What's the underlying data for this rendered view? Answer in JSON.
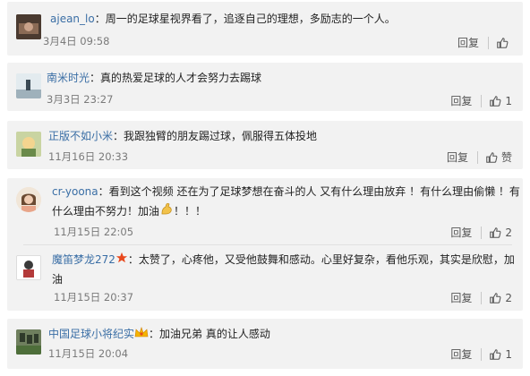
{
  "comments": [
    {
      "user": "ajean_lo",
      "text": "周一的足球星视界看了，追逐自己的理想，多励志的一个人。",
      "time": "3月4日 09:58",
      "reply_label": "回复",
      "like": ""
    },
    {
      "user": "南米时光",
      "text": "真的热爱足球的人才会努力去踢球",
      "time": "3月3日 23:27",
      "reply_label": "回复",
      "like": "1"
    },
    {
      "user": "正版不如小米",
      "text": "我跟独臂的朋友踢过球，佩服得五体投地",
      "time": "11月16日 20:33",
      "reply_label": "回复",
      "like": "赞"
    },
    {
      "user": "cr-yoona",
      "text_line1": "看到这个视频 还在为了足球梦想在奋斗的人 又有什么理由放弃 ！有什么理由偷懒 ！有",
      "text_line2": "什么理由不努力！加油",
      "text_line2_tail": "！！！",
      "time": "11月15日 22:05",
      "reply_label": "回复",
      "like": "2"
    },
    {
      "user": "魔笛梦龙272",
      "text_line1": "太赞了，心疼他，又受他鼓舞和感动。心里好复杂，看他乐观，其实是欣慰，加",
      "text_line2": "油",
      "time": "11月15日 20:37",
      "reply_label": "回复",
      "like": "2"
    },
    {
      "user": "中国足球小将纪实",
      "text": "加油兄弟 真的让人感动",
      "time": "11月15日 20:04",
      "reply_label": "回复",
      "like": "1"
    }
  ],
  "separator": "：",
  "icons": {
    "like": "thumbs-up-icon",
    "star": "star-badge-icon",
    "crown": "vip-crown-icon",
    "muscle": "flexed-biceps-emoji"
  },
  "colors": {
    "username": "#3a6ea5",
    "card_bg": "#f2f2f2",
    "time": "#7a7a7a",
    "star": "#e8481c"
  }
}
